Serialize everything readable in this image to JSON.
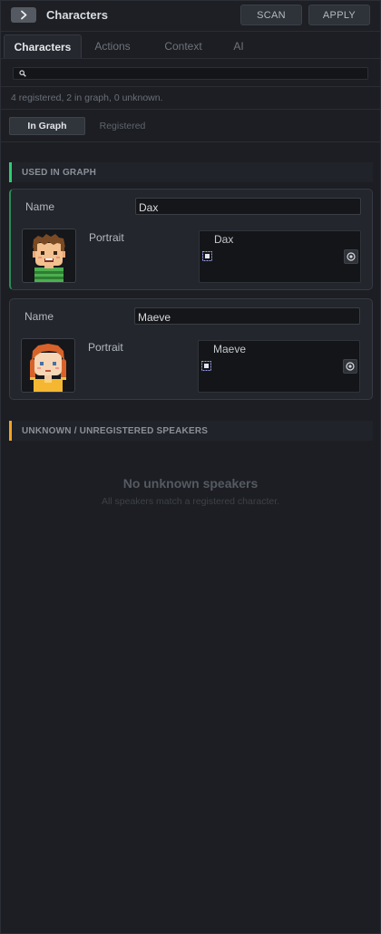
{
  "header": {
    "title": "Characters",
    "scan_label": "SCAN",
    "apply_label": "APPLY"
  },
  "tabs": [
    {
      "label": "Characters",
      "active": true
    },
    {
      "label": "Actions",
      "active": false
    },
    {
      "label": "Context",
      "active": false
    },
    {
      "label": "AI",
      "active": false
    }
  ],
  "search": {
    "value": "",
    "placeholder": ""
  },
  "summary": "4 registered, 2 in graph, 0 unknown.",
  "subtabs": [
    {
      "label": "In Graph",
      "active": true
    },
    {
      "label": "Registered",
      "active": false
    }
  ],
  "used_section": {
    "title": "USED IN GRAPH",
    "accent": "#2ecc71",
    "characters": [
      {
        "name_label": "Name",
        "name_value": "Dax",
        "portrait_label": "Portrait",
        "portrait_value": "Dax"
      },
      {
        "name_label": "Name",
        "name_value": "Maeve",
        "portrait_label": "Portrait",
        "portrait_value": "Maeve"
      }
    ]
  },
  "unknown_section": {
    "title": "UNKNOWN / UNREGISTERED SPEAKERS",
    "accent": "#f1a420",
    "empty_title": "No unknown speakers",
    "empty_subtitle": "All speakers match a registered character."
  },
  "icons": {
    "collapse": "chevron-right-icon",
    "search": "search-icon",
    "sprite": "sprite-icon",
    "target": "target-icon"
  }
}
